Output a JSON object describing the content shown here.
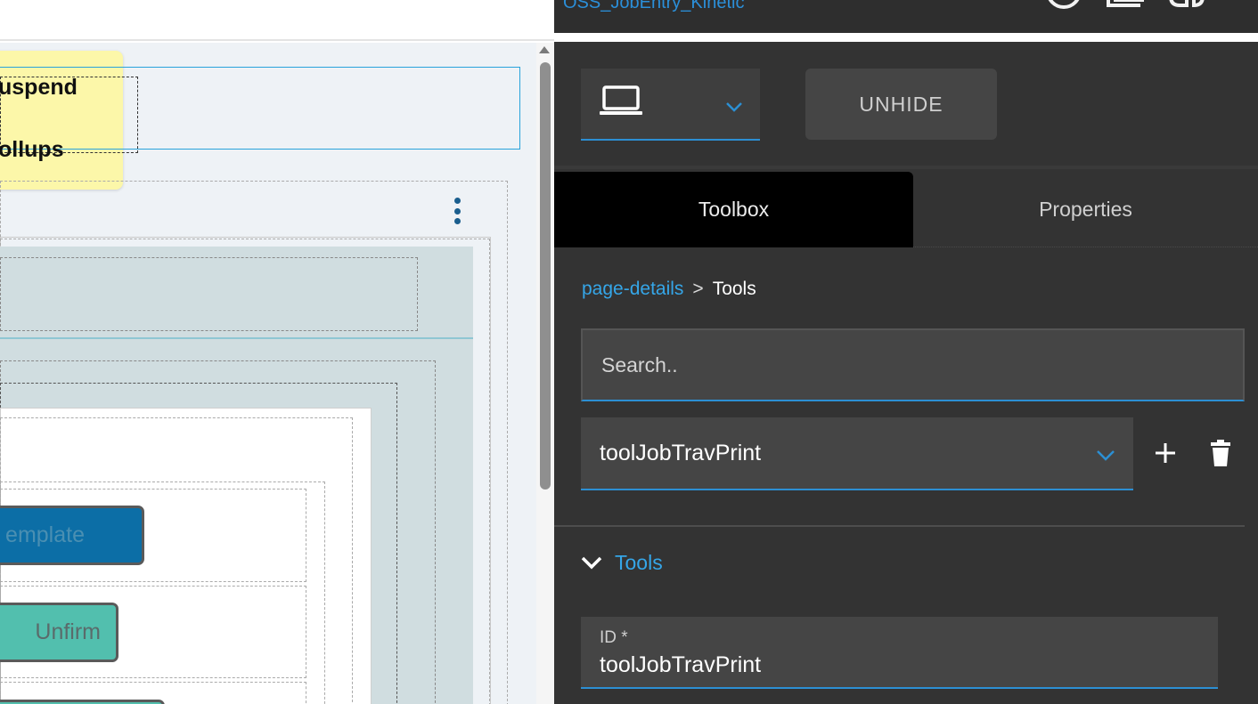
{
  "canvas": {
    "sticky_note": {
      "line1": "uspend",
      "line2": "ollups"
    },
    "buttons": [
      {
        "label": "emplate",
        "bg": "#0c6ea6",
        "color": "#4a8fb2"
      },
      {
        "label": "Unfirm",
        "bg": "#52bfae",
        "color": "#5a6b6b"
      }
    ]
  },
  "panel": {
    "top_title": "OSS_JobEntry_Kinetic",
    "unhide_label": "UNHIDE",
    "tabs": {
      "toolbox": "Toolbox",
      "properties": "Properties"
    },
    "breadcrumb": {
      "parent": "page-details",
      "separator": ">",
      "current": "Tools"
    },
    "search": {
      "placeholder": "Search..",
      "value": ""
    },
    "tool_select": {
      "value": "toolJobTravPrint"
    },
    "section": {
      "label": "Tools"
    },
    "id_field": {
      "label": "ID *",
      "value": "toolJobTravPrint"
    },
    "colors": {
      "accent": "#35a6e8",
      "panel_bg": "#333333",
      "field_bg": "#454545"
    },
    "icons": [
      "laptop-icon",
      "chevron-down-icon",
      "plus-icon",
      "trash-icon",
      "chevron-down-icon"
    ]
  }
}
